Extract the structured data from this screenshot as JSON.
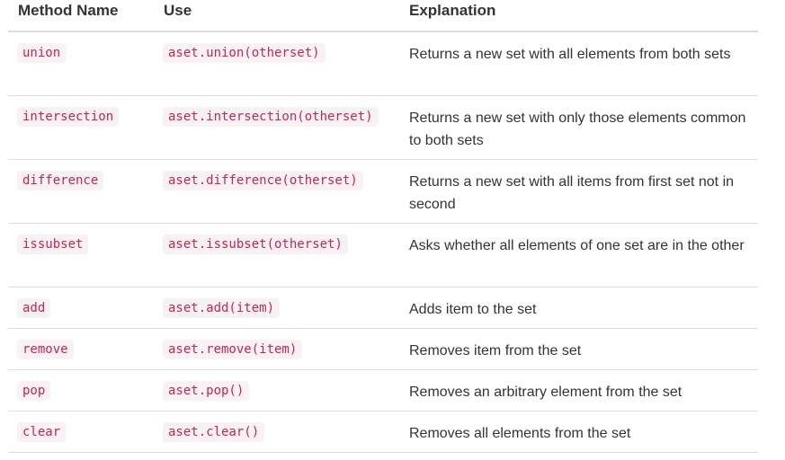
{
  "table": {
    "headers": {
      "method_name": "Method Name",
      "use": "Use",
      "explanation": "Explanation"
    },
    "rows": [
      {
        "method": "union",
        "use": "aset.union(otherset)",
        "explanation": "Returns a new set with all elements from both sets"
      },
      {
        "method": "intersection",
        "use": "aset.intersection(otherset)",
        "explanation": "Returns a new set with only those elements common to both sets"
      },
      {
        "method": "difference",
        "use": "aset.difference(otherset)",
        "explanation": "Returns a new set with all items from first set not in second"
      },
      {
        "method": "issubset",
        "use": "aset.issubset(otherset)",
        "explanation": "Asks whether all elements of one set are in the other"
      },
      {
        "method": "add",
        "use": "aset.add(item)",
        "explanation": "Adds item to the set"
      },
      {
        "method": "remove",
        "use": "aset.remove(item)",
        "explanation": "Removes item from the set"
      },
      {
        "method": "pop",
        "use": "aset.pop()",
        "explanation": "Removes an arbitrary element from the set"
      },
      {
        "method": "clear",
        "use": "aset.clear()",
        "explanation": "Removes all elements from the set"
      }
    ]
  },
  "colors": {
    "code_text": "#c7254e",
    "code_background": "#f9f2f4",
    "body_text": "#333333",
    "divider": "#dddddd"
  }
}
